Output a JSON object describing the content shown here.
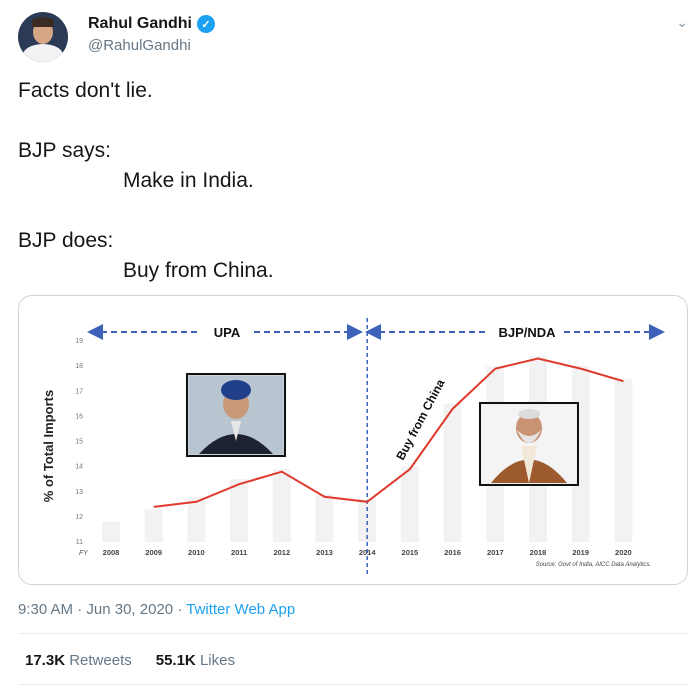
{
  "author": {
    "name": "Rahul Gandhi",
    "handle": "@RahulGandhi",
    "verified": true,
    "avatar_icon": "profile-photo"
  },
  "menu_icon": "chevron-down-icon",
  "tweet": {
    "lines": [
      "Facts don't lie.",
      "",
      "BJP says:",
      "Make in India.",
      "",
      "BJP does:",
      "Buy from China."
    ]
  },
  "chart_data": {
    "type": "line",
    "ylabel": "% of Total Imports",
    "x_prefix": "FY",
    "x": [
      "2008",
      "2009",
      "2010",
      "2011",
      "2012",
      "2013",
      "2014",
      "2015",
      "2016",
      "2017",
      "2018",
      "2019",
      "2020"
    ],
    "yticks": [
      11,
      12,
      13,
      14,
      15,
      16,
      17,
      18,
      19
    ],
    "ylim": [
      11,
      19
    ],
    "series": [
      {
        "values": [
          null,
          12.4,
          12.6,
          13.3,
          13.8,
          12.8,
          12.6,
          13.9,
          16.3,
          17.9,
          18.3,
          17.9,
          17.4
        ],
        "color": "#e03a2e"
      }
    ],
    "background_bars": [
      11.8,
      12.3,
      12.8,
      13.5,
      13.9,
      12.9,
      12.7,
      14.0,
      16.5,
      18.0,
      18.4,
      18.0,
      17.5
    ],
    "annotations": {
      "upa": "UPA",
      "nda": "BJP/NDA",
      "buy": "Buy from China",
      "source": "Source: Govt of India, AICC Data Analytics."
    },
    "divider_year": "2014",
    "grid": false
  },
  "footer": {
    "time": "9:30 AM",
    "date": "Jun 30, 2020",
    "sep": "·",
    "app": "Twitter Web App"
  },
  "stats": {
    "retweets_count": "17.3K",
    "retweets_label": "Retweets",
    "likes_count": "55.1K",
    "likes_label": "Likes"
  },
  "colors": {
    "accent": "#1da1f2",
    "arrow": "#3b62b8",
    "line": "#e03a2e"
  }
}
